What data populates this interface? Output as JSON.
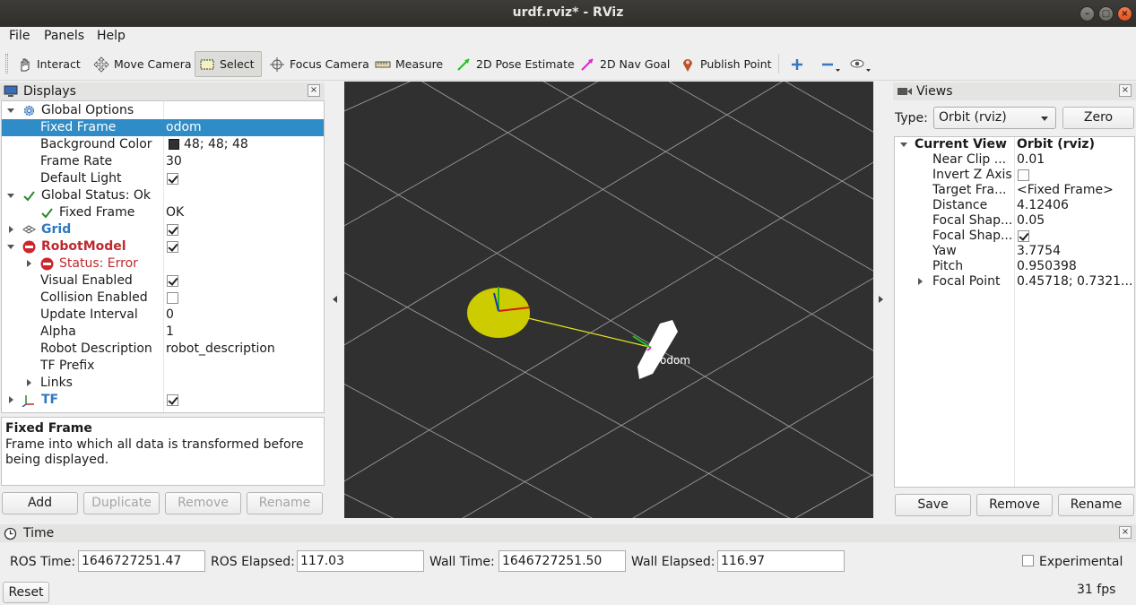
{
  "window": {
    "title": "urdf.rviz* - RViz"
  },
  "menu": {
    "file": "File",
    "panels": "Panels",
    "help": "Help"
  },
  "toolbar": {
    "interact": "Interact",
    "move_camera": "Move Camera",
    "select": "Select",
    "focus_camera": "Focus Camera",
    "measure": "Measure",
    "pose_estimate": "2D Pose Estimate",
    "nav_goal": "2D Nav Goal",
    "publish_point": "Publish Point"
  },
  "displays": {
    "title": "Displays",
    "rows": [
      {
        "label": "Global Options",
        "value": ""
      },
      {
        "label": "Fixed Frame",
        "value": "odom"
      },
      {
        "label": "Background Color",
        "value": "48; 48; 48"
      },
      {
        "label": "Frame Rate",
        "value": "30"
      },
      {
        "label": "Default Light",
        "value": ""
      },
      {
        "label": "Global Status: Ok",
        "value": ""
      },
      {
        "label": "Fixed Frame",
        "value": "OK"
      },
      {
        "label": "Grid",
        "value": ""
      },
      {
        "label": "RobotModel",
        "value": ""
      },
      {
        "label": "Status: Error",
        "value": ""
      },
      {
        "label": "Visual Enabled",
        "value": ""
      },
      {
        "label": "Collision Enabled",
        "value": ""
      },
      {
        "label": "Update Interval",
        "value": "0"
      },
      {
        "label": "Alpha",
        "value": "1"
      },
      {
        "label": "Robot Description",
        "value": "robot_description"
      },
      {
        "label": "TF Prefix",
        "value": ""
      },
      {
        "label": "Links",
        "value": ""
      },
      {
        "label": "TF",
        "value": ""
      }
    ],
    "desc_title": "Fixed Frame",
    "desc_text": "Frame into which all data is transformed before being displayed.",
    "buttons": {
      "add": "Add",
      "duplicate": "Duplicate",
      "remove": "Remove",
      "rename": "Rename"
    }
  },
  "viewport": {
    "frame_label": "odom",
    "background_color": "#303030",
    "grid_color": "#a0a0a0"
  },
  "views": {
    "title": "Views",
    "type_label": "Type:",
    "type_value": "Orbit (rviz)",
    "zero": "Zero",
    "rows": [
      {
        "label": "Current View",
        "value": "Orbit (rviz)"
      },
      {
        "label": "Near Clip ...",
        "value": "0.01"
      },
      {
        "label": "Invert Z Axis",
        "value": ""
      },
      {
        "label": "Target Fra...",
        "value": "<Fixed Frame>"
      },
      {
        "label": "Distance",
        "value": "4.12406"
      },
      {
        "label": "Focal Shap...",
        "value": "0.05"
      },
      {
        "label": "Focal Shap...",
        "value": ""
      },
      {
        "label": "Yaw",
        "value": "3.7754"
      },
      {
        "label": "Pitch",
        "value": "0.950398"
      },
      {
        "label": "Focal Point",
        "value": "0.45718; 0.7321..."
      }
    ],
    "buttons": {
      "save": "Save",
      "remove": "Remove",
      "rename": "Rename"
    }
  },
  "time": {
    "title": "Time",
    "ros_time_label": "ROS Time:",
    "ros_time": "1646727251.47",
    "ros_elapsed_label": "ROS Elapsed:",
    "ros_elapsed": "117.03",
    "wall_time_label": "Wall Time:",
    "wall_time": "1646727251.50",
    "wall_elapsed_label": "Wall Elapsed:",
    "wall_elapsed": "116.97",
    "experimental": "Experimental",
    "reset": "Reset",
    "fps": "31 fps"
  },
  "colors": {
    "selection": "#308cc6",
    "error": "#c0282d",
    "link": "#2f78c0",
    "accent_titlebar": "#3d3c38"
  }
}
